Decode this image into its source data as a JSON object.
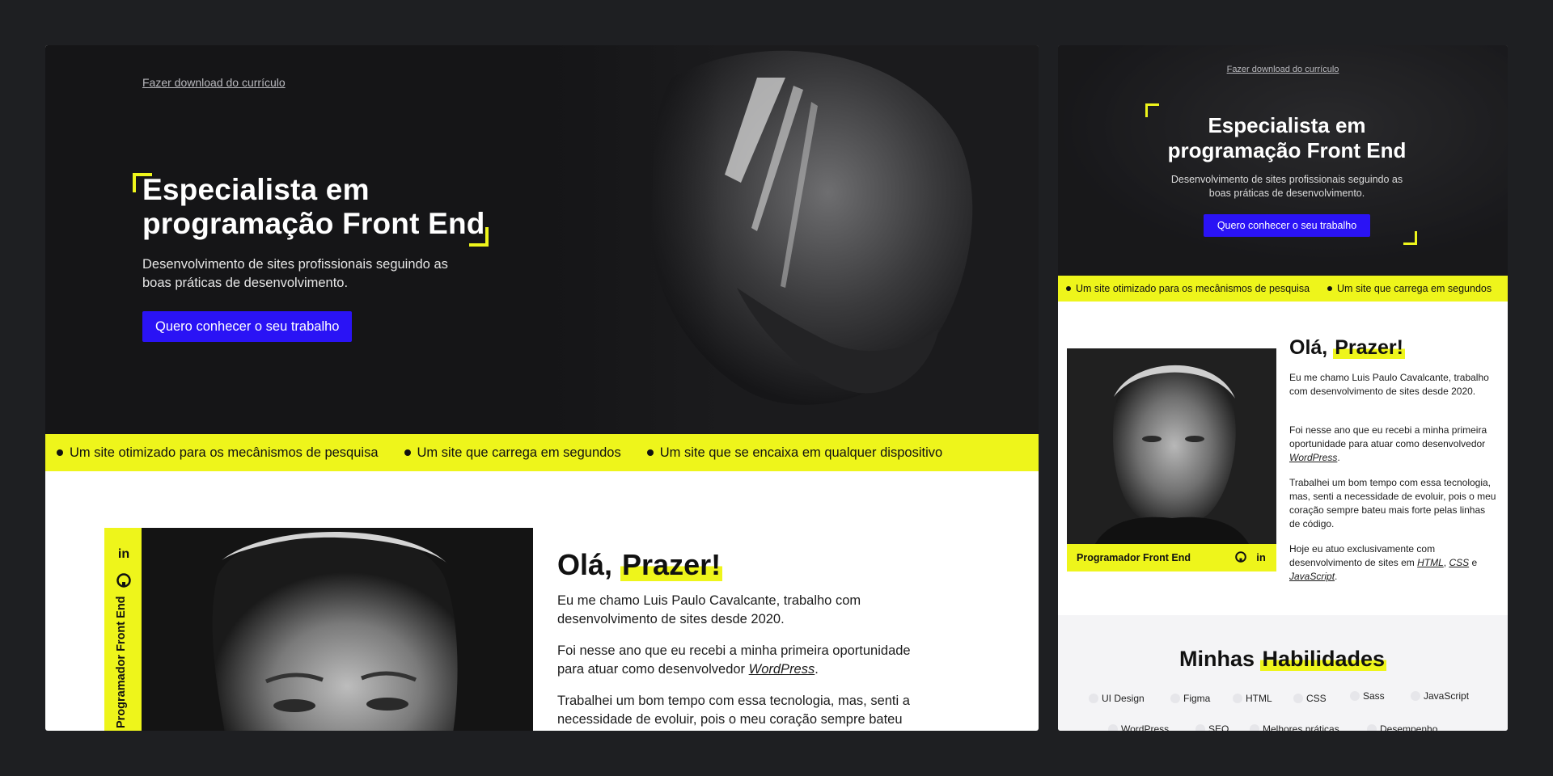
{
  "desktop": {
    "hero": {
      "download_link": "Fazer download do currículo",
      "title_line1": "Especialista em",
      "title_line2": "programação Front End",
      "subtitle_line1": "Desenvolvimento de sites profissionais seguindo as",
      "subtitle_line2": "boas práticas de desenvolvimento.",
      "cta": "Quero conhecer o seu trabalho"
    },
    "ticker": [
      "Um site otimizado para os mecânismos de pesquisa",
      "Um site que carrega em segundos",
      "Um site que se encaixa em qualquer dispositivo"
    ],
    "about": {
      "side_label": "Programador Front End",
      "heading_prefix": "Olá, ",
      "heading_highlight": "Prazer!",
      "p1_line1": "Eu me chamo Luis Paulo Cavalcante, trabalho com",
      "p1_line2": "desenvolvimento de sites desde 2020.",
      "p2_line1": "Foi nesse ano que eu recebi a minha primeira oportunidade",
      "p2_line2": "para atuar como desenvolvedor ",
      "p2_link": "WordPress",
      "p2_end": ".",
      "p3_line1": "Trabalhei um bom tempo com essa tecnologia, mas, senti a",
      "p3_line2": "necessidade de evoluir, pois o meu coração sempre bateu"
    }
  },
  "mobile": {
    "hero": {
      "download_link": "Fazer download do currículo",
      "title_line1": "Especialista em",
      "title_line2": "programação Front End",
      "subtitle_line1": "Desenvolvimento de sites profissionais seguindo as",
      "subtitle_line2": "boas práticas de desenvolvimento.",
      "cta": "Quero conhecer o seu trabalho"
    },
    "ticker": [
      "Um site otimizado para os mecânismos de pesquisa",
      "Um site que carrega em segundos"
    ],
    "about": {
      "caption": "Programador Front End",
      "heading_prefix": "Olá, ",
      "heading_highlight": "Prazer!",
      "p1": "Eu me chamo Luis Paulo Cavalcante, trabalho com desenvolvimento de sites desde 2020.",
      "p2_text": "Foi nesse ano que eu recebi a minha primeira oportunidade para atuar como desenvolvedor ",
      "p2_link": "WordPress",
      "p2_end": ".",
      "p3": "Trabalhei um bom tempo com essa tecnologia, mas, senti a necessidade de evoluir, pois o meu coração sempre bateu mais forte pelas linhas de código.",
      "p4_text": "Hoje eu atuo exclusivamente com desenvolvimento de sites em ",
      "p4_html": "HTML",
      "p4_sep": ", ",
      "p4_css": "CSS",
      "p4_and": " e ",
      "p4_js": "JavaScript",
      "p4_end": "."
    },
    "skills": {
      "heading_prefix": "Minhas ",
      "heading_highlight": "Habilidades",
      "items": [
        "UI Design",
        "Figma",
        "HTML",
        "CSS",
        "Sass",
        "JavaScript",
        "WordPress",
        "SEO",
        "Melhores práticas",
        "Desempenho"
      ]
    }
  },
  "icons": {
    "linkedin": "linkedin-icon",
    "github": "github-icon"
  },
  "colors": {
    "accent_yellow": "#eef51b",
    "button_blue": "#2a13f5",
    "hero_dark": "#151517",
    "page_bg": "#1e1f22"
  }
}
